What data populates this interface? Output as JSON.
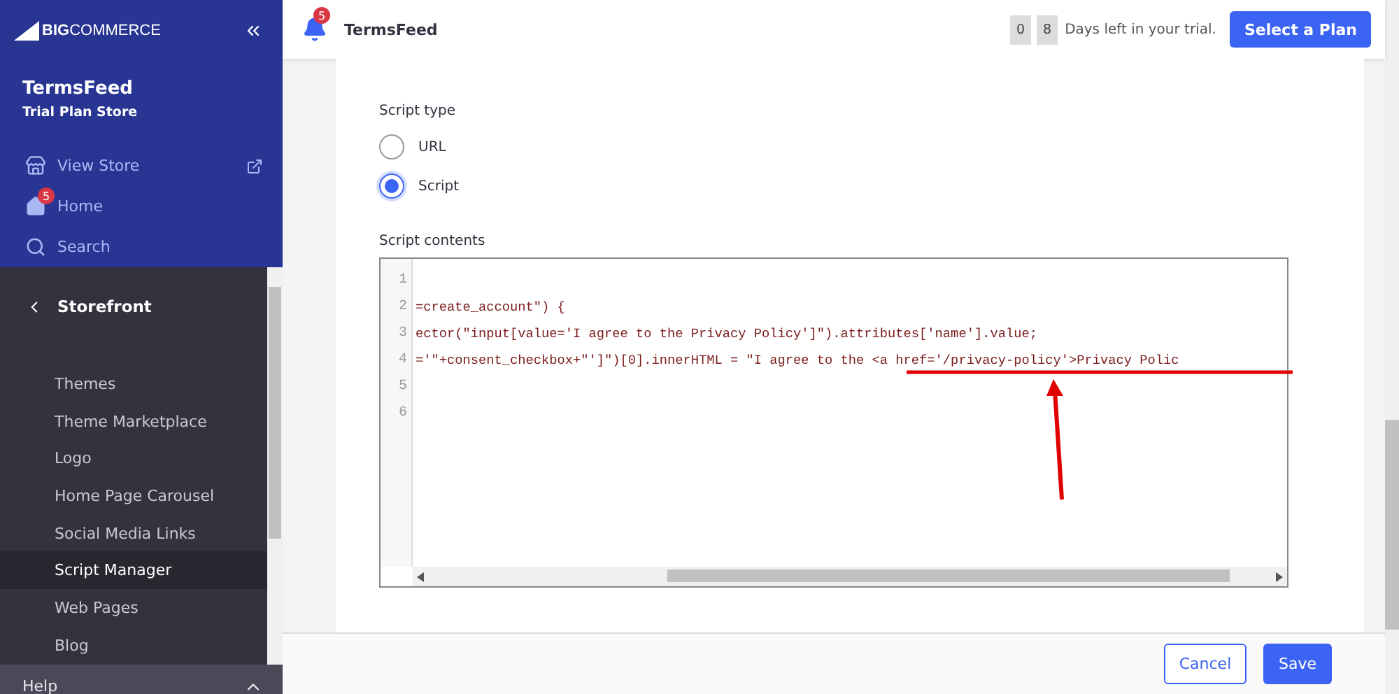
{
  "brand": {
    "part_1": "BIG",
    "part_2": "COMMERCE"
  },
  "store": {
    "name": "TermsFeed",
    "plan": "Trial Plan Store"
  },
  "top_nav": [
    {
      "kind": "store",
      "label": "View Store"
    },
    {
      "kind": "home",
      "label": "Home",
      "badge": "5"
    },
    {
      "kind": "search",
      "label": "Search"
    }
  ],
  "section": {
    "title": "Storefront",
    "items": [
      {
        "label": "Themes",
        "selected": false
      },
      {
        "label": "Theme Marketplace",
        "selected": false
      },
      {
        "label": "Logo",
        "selected": false
      },
      {
        "label": "Home Page Carousel",
        "selected": false
      },
      {
        "label": "Social Media Links",
        "selected": false
      },
      {
        "label": "Script Manager",
        "selected": true
      },
      {
        "label": "Web Pages",
        "selected": false
      },
      {
        "label": "Blog",
        "selected": false
      }
    ]
  },
  "help": {
    "label": "Help"
  },
  "header": {
    "badge": "5",
    "store": "TermsFeed",
    "days": [
      "0",
      "8"
    ],
    "trial_text": "Days left in your trial.",
    "cta": "Select a Plan"
  },
  "script_type": {
    "label": "Script type",
    "options": [
      {
        "label": "URL",
        "selected": false
      },
      {
        "label": "Script",
        "selected": true
      }
    ]
  },
  "script_contents": {
    "label": "Script contents",
    "lines": [
      {
        "number": "1"
      },
      {
        "number": "2",
        "code": "=create_account\") {"
      },
      {
        "number": "3",
        "code": "ector(\"input[value='I agree to the Privacy Policy']\").attributes['name'].value;"
      },
      {
        "number": "4",
        "code": "='\"+consent_checkbox+\"']\")[0].innerHTML = \"I agree to the <a href='/privacy-policy'>Privacy Polic"
      },
      {
        "number": "5"
      },
      {
        "number": "6"
      }
    ]
  },
  "footer": {
    "cancel": "Cancel",
    "save": "Save"
  }
}
